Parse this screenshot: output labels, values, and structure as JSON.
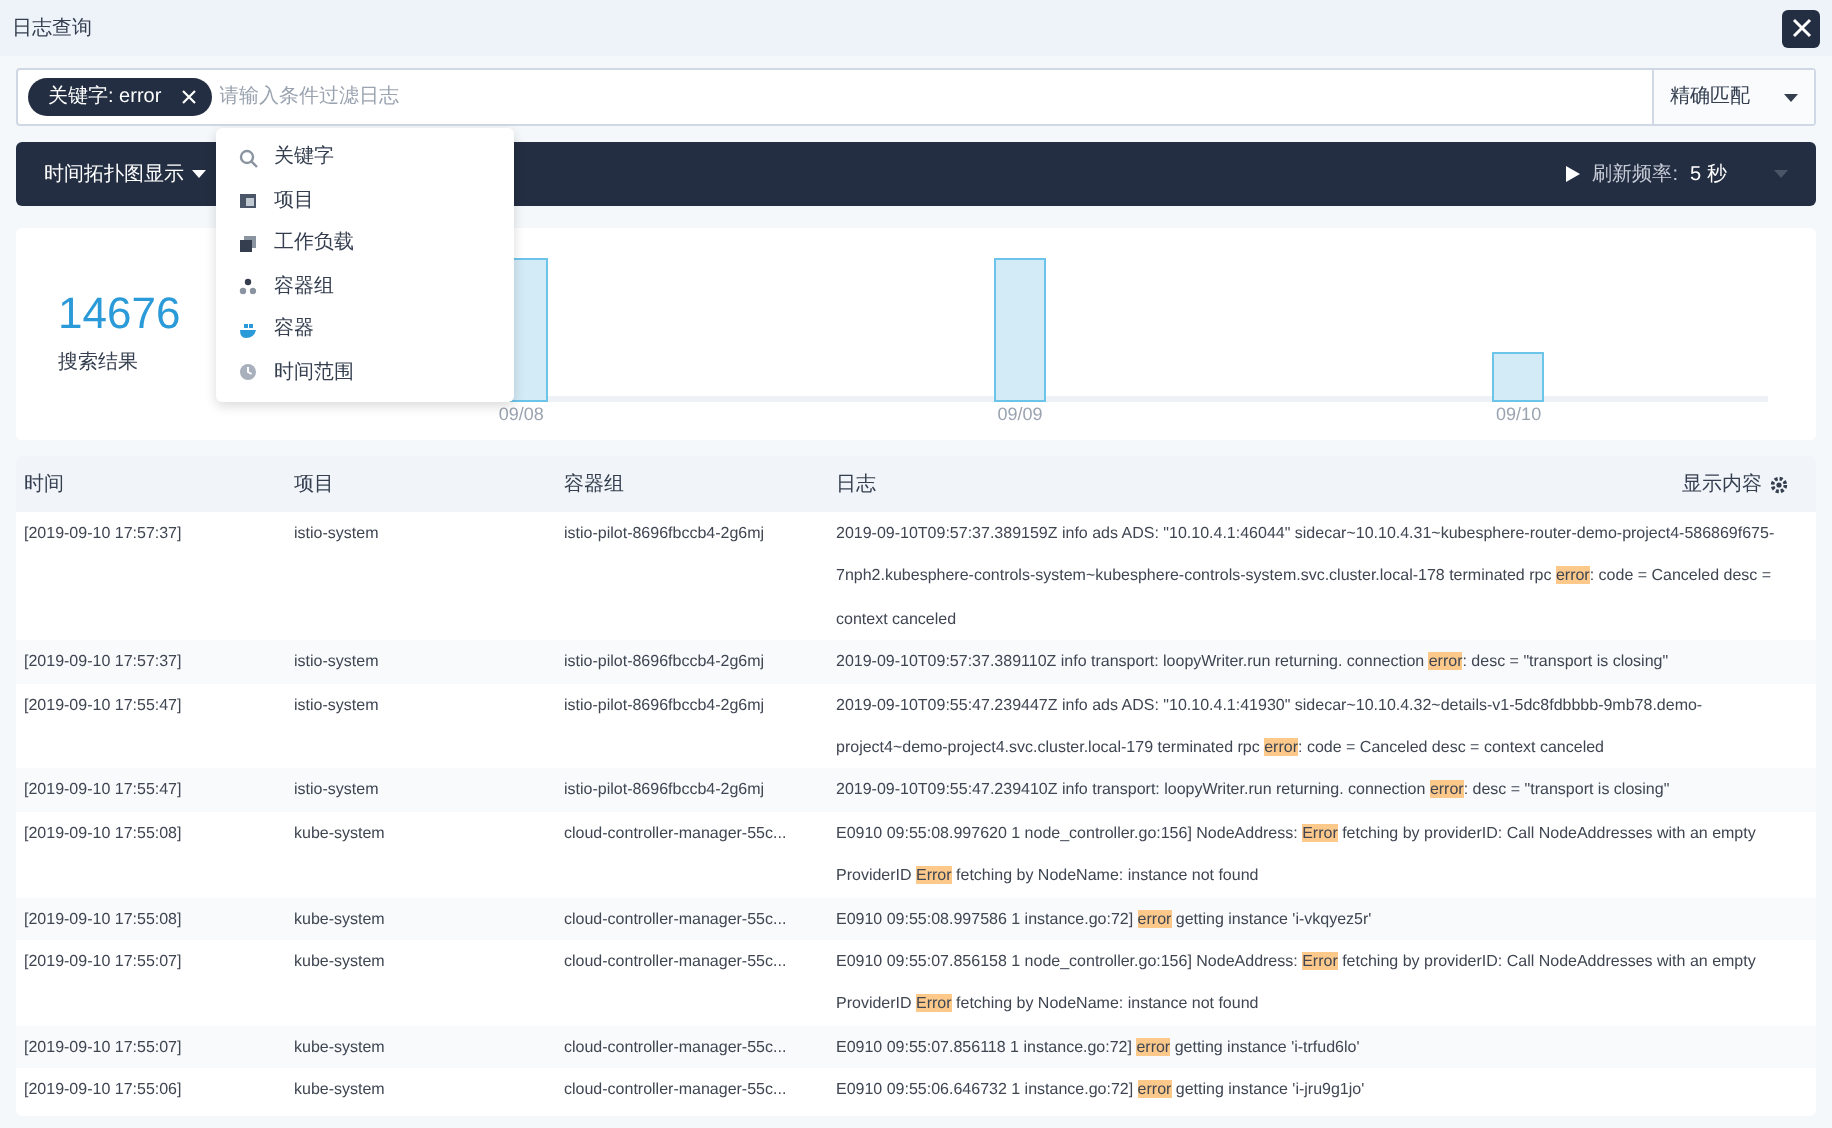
{
  "window": {
    "title": "日志查询"
  },
  "search": {
    "tags": [
      {
        "label": "关键字: error"
      }
    ],
    "placeholder": "请输入条件过滤日志",
    "match_mode": "精确匹配"
  },
  "dropdown": {
    "items": [
      {
        "label": "关键字",
        "kind": "search"
      },
      {
        "label": "项目",
        "kind": "project"
      },
      {
        "label": "工作负载",
        "kind": "workload"
      },
      {
        "label": "容器组",
        "kind": "pod"
      },
      {
        "label": "容器",
        "kind": "container"
      },
      {
        "label": "时间范围",
        "kind": "time"
      }
    ]
  },
  "toolbar": {
    "view_toggle": "时间拓扑图显示",
    "refresh_label": "刷新频率:",
    "refresh_value": "5 秒"
  },
  "summary": {
    "count": "14676",
    "label": "搜索结果"
  },
  "chart": {
    "x_labels": [
      "09/08",
      "09/09",
      "09/10"
    ]
  },
  "table": {
    "columns": [
      "时间",
      "项目",
      "容器组",
      "日志"
    ],
    "settings_label": "显示内容",
    "rows": [
      {
        "time": "[2019-09-10 17:57:37]",
        "project": "istio-system",
        "pod": "istio-pilot-8696fbccb4-2g6mj",
        "log": [
          {
            "text": "2019-09-10T09:57:37.389159Z info ads ADS: \"10.10.4.1:46044\" sidecar~10.10.4.31~kubesphere-router-demo-project4-586869f675-7nph2.kubesphere-controls-system~kubesphere-controls-system.svc.cluster.local-178 terminated rpc ",
            "highlight": false
          },
          {
            "text": "error",
            "highlight": true
          },
          {
            "text": ": code = Canceled desc = context canceled",
            "highlight": false
          }
        ]
      },
      {
        "time": "[2019-09-10 17:57:37]",
        "project": "istio-system",
        "pod": "istio-pilot-8696fbccb4-2g6mj",
        "log": [
          {
            "text": "2019-09-10T09:57:37.389110Z info transport: loopyWriter.run returning. connection ",
            "highlight": false
          },
          {
            "text": "error",
            "highlight": true
          },
          {
            "text": ": desc = \"transport is closing\"",
            "highlight": false
          }
        ]
      },
      {
        "time": "[2019-09-10 17:55:47]",
        "project": "istio-system",
        "pod": "istio-pilot-8696fbccb4-2g6mj",
        "log": [
          {
            "text": "2019-09-10T09:55:47.239447Z info ads ADS: \"10.10.4.1:41930\" sidecar~10.10.4.32~details-v1-5dc8fdbbbb-9mb78.demo-project4~demo-project4.svc.cluster.local-179 terminated rpc ",
            "highlight": false
          },
          {
            "text": "error",
            "highlight": true
          },
          {
            "text": ": code = Canceled desc = context canceled",
            "highlight": false
          }
        ]
      },
      {
        "time": "[2019-09-10 17:55:47]",
        "project": "istio-system",
        "pod": "istio-pilot-8696fbccb4-2g6mj",
        "log": [
          {
            "text": "2019-09-10T09:55:47.239410Z info transport: loopyWriter.run returning. connection ",
            "highlight": false
          },
          {
            "text": "error",
            "highlight": true
          },
          {
            "text": ": desc = \"transport is closing\"",
            "highlight": false
          }
        ]
      },
      {
        "time": "[2019-09-10 17:55:08]",
        "project": "kube-system",
        "pod": "cloud-controller-manager-55c...",
        "log": [
          {
            "text": "E0910 09:55:08.997620 1 node_controller.go:156] NodeAddress: ",
            "highlight": false
          },
          {
            "text": "Error",
            "highlight": true
          },
          {
            "text": " fetching by providerID: Call NodeAddresses with an empty ProviderID ",
            "highlight": false
          },
          {
            "text": "Error",
            "highlight": true
          },
          {
            "text": " fetching by NodeName: instance not found",
            "highlight": false
          }
        ]
      },
      {
        "time": "[2019-09-10 17:55:08]",
        "project": "kube-system",
        "pod": "cloud-controller-manager-55c...",
        "log": [
          {
            "text": "E0910 09:55:08.997586 1 instance.go:72] ",
            "highlight": false
          },
          {
            "text": "error",
            "highlight": true
          },
          {
            "text": " getting instance 'i-vkqyez5r'",
            "highlight": false
          }
        ]
      },
      {
        "time": "[2019-09-10 17:55:07]",
        "project": "kube-system",
        "pod": "cloud-controller-manager-55c...",
        "log": [
          {
            "text": "E0910 09:55:07.856158 1 node_controller.go:156] NodeAddress: ",
            "highlight": false
          },
          {
            "text": "Error",
            "highlight": true
          },
          {
            "text": " fetching by providerID: Call NodeAddresses with an empty ProviderID ",
            "highlight": false
          },
          {
            "text": "Error",
            "highlight": true
          },
          {
            "text": " fetching by NodeName: instance not found",
            "highlight": false
          }
        ]
      },
      {
        "time": "[2019-09-10 17:55:07]",
        "project": "kube-system",
        "pod": "cloud-controller-manager-55c...",
        "log": [
          {
            "text": "E0910 09:55:07.856118 1 instance.go:72] ",
            "highlight": false
          },
          {
            "text": "error",
            "highlight": true
          },
          {
            "text": " getting instance 'i-trfud6lo'",
            "highlight": false
          }
        ]
      },
      {
        "time": "[2019-09-10 17:55:06]",
        "project": "kube-system",
        "pod": "cloud-controller-manager-55c...",
        "log": [
          {
            "text": "E0910 09:55:06.646732 1 instance.go:72] ",
            "highlight": false
          },
          {
            "text": "error",
            "highlight": true
          },
          {
            "text": " getting instance 'i-jru9g1jo'",
            "highlight": false
          }
        ]
      }
    ]
  }
}
